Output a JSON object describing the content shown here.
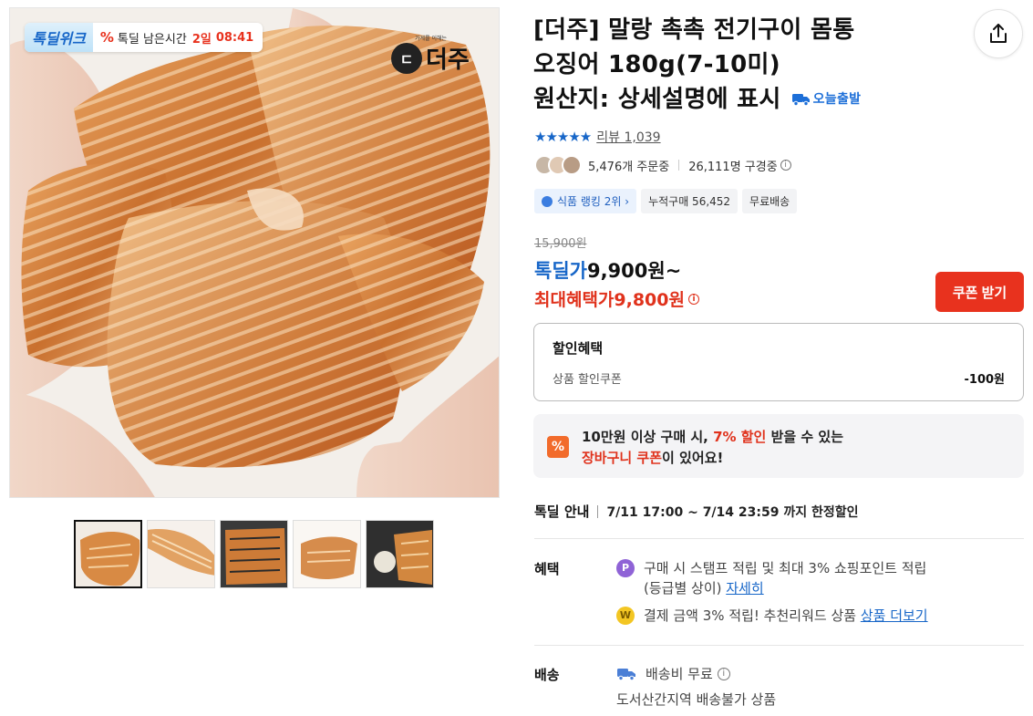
{
  "gallery": {
    "badge": {
      "week_label": "톡딜위크",
      "percent_icon": "%",
      "remain_label": "톡딜 남은시간",
      "days": "2일",
      "time": "08:41"
    },
    "brand": {
      "mark": "ㄷ",
      "tagline": "가게를 이해는",
      "name": "더주"
    },
    "thumbnail_count": 5
  },
  "product": {
    "title_line1": "[더주] 말랑 촉촉 전기구이 몸통",
    "title_line2": "오징어 180g(7-10미)",
    "title_line3": "원산지: 상세설명에 표시",
    "today_ship": "오늘출발",
    "stars": "★★★★★",
    "review_label": "리뷰 1,039",
    "orders": "5,476개 주문중",
    "viewers": "26,111명 구경중",
    "chips": [
      "식품 랭킹 2위 ›",
      "누적구매 56,452",
      "무료배송"
    ]
  },
  "price": {
    "original": "15,900원",
    "deal_label": "톡딜가",
    "deal_value": "9,900원~",
    "max_label": "최대혜택가9,800원",
    "coupon_button": "쿠폰 받기"
  },
  "discount": {
    "heading": "할인혜택",
    "item_label": "상품 할인쿠폰",
    "item_value": "-100원"
  },
  "cart_coupon": {
    "icon": "%",
    "line1_a": "10만원 이상 구매 시, ",
    "line1_b": "7% 할인",
    "line1_c": " 받을 수 있는",
    "line2_a": "장바구니 쿠폰",
    "line2_b": "이 있어요!"
  },
  "deal_info": {
    "label": "톡딜 안내",
    "period": "7/11 17:00 ~ 7/14 23:59 까지 한정할인"
  },
  "benefits": {
    "label": "혜택",
    "item1_text": "구매 시 스탬프 적립 및 최대 3% 쇼핑포인트 적립",
    "item1_text2": "(등급별 상이) ",
    "item1_link": "자세히",
    "item2_text": "결제 금액 3% 적립! 추천리워드 상품 ",
    "item2_link": "상품 더보기",
    "icon1": "P",
    "icon2": "W"
  },
  "shipping": {
    "label": "배송",
    "fee": "배송비 무료",
    "note": "도서산간지역 배송불가 상품"
  },
  "colors": {
    "accent_blue": "#1766c8",
    "accent_red": "#e0321c",
    "coupon_button": "#e8321e"
  }
}
